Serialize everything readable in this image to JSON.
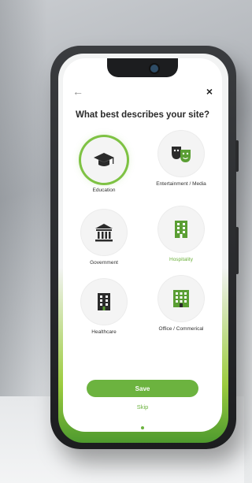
{
  "header": {
    "back_icon": "arrow-left-icon",
    "close_icon": "close-icon",
    "back_glyph": "←",
    "close_glyph": "×"
  },
  "question": {
    "title": "What best describes your site?"
  },
  "options": [
    {
      "label": "Education",
      "icon": "graduation-cap-icon",
      "selected": true
    },
    {
      "label": "Entertainment / Media",
      "icon": "theater-masks-icon",
      "selected": false
    },
    {
      "label": "Government",
      "icon": "government-building-icon",
      "selected": false
    },
    {
      "label": "Hospitality",
      "icon": "hotel-building-icon",
      "selected": false
    },
    {
      "label": "Healthcare",
      "icon": "hospital-building-icon",
      "selected": false
    },
    {
      "label": "Office / Commerical",
      "icon": "office-building-icon",
      "selected": false
    }
  ],
  "actions": {
    "save_label": "Save",
    "skip_label": "Skip"
  },
  "colors": {
    "accent": "#6cb33f",
    "accent_light": "#7ec243",
    "text_dark": "#2a2a2a",
    "icon_dark": "#2b2b2b",
    "icon_green": "#5a9e33"
  }
}
